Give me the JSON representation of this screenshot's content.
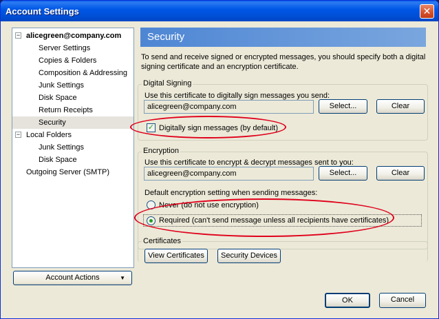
{
  "window": {
    "title": "Account Settings",
    "close_glyph": "✕"
  },
  "tree": {
    "rows": [
      {
        "label": "alicegreen@company.com",
        "expander": "−"
      },
      {
        "label": "Server Settings"
      },
      {
        "label": "Copies & Folders"
      },
      {
        "label": "Composition & Addressing"
      },
      {
        "label": "Junk Settings"
      },
      {
        "label": "Disk Space"
      },
      {
        "label": "Return Receipts"
      },
      {
        "label": "Security"
      },
      {
        "label": "Local Folders",
        "expander": "−"
      },
      {
        "label": "Junk Settings"
      },
      {
        "label": "Disk Space"
      },
      {
        "label": "Outgoing Server (SMTP)"
      }
    ],
    "selected_label": "Security"
  },
  "account_actions": {
    "label": "Account Actions",
    "arrow": "▼"
  },
  "pane": {
    "title": "Security",
    "intro": "To send and receive signed or encrypted messages, you should specify both a digital signing certificate and an encryption certificate."
  },
  "signing": {
    "group_title": "Digital Signing",
    "prompt": "Use this certificate to digitally sign messages you send:",
    "cert_value": "alicegreen@company.com",
    "select_label": "Select...",
    "clear_label": "Clear",
    "checkbox_label": "Digitally sign messages (by default)",
    "checked": true,
    "check_glyph": "✓"
  },
  "encryption": {
    "group_title": "Encryption",
    "prompt": "Use this certificate to encrypt & decrypt messages sent to you:",
    "cert_value": "alicegreen@company.com",
    "select_label": "Select...",
    "clear_label": "Clear",
    "default_label": "Default encryption setting when sending messages:",
    "options": [
      {
        "label": "Never (do not use encryption)",
        "selected": false
      },
      {
        "label": "Required (can't send message unless all recipients have certificates)",
        "selected": true
      }
    ]
  },
  "certificates": {
    "group_title": "Certificates",
    "view_label": "View Certificates",
    "devices_label": "Security Devices"
  },
  "footer": {
    "ok_label": "OK",
    "cancel_label": "Cancel"
  },
  "colors": {
    "titlebar": "#0058e6",
    "header": "#6b9bd6",
    "annotation": "#e0001b"
  }
}
